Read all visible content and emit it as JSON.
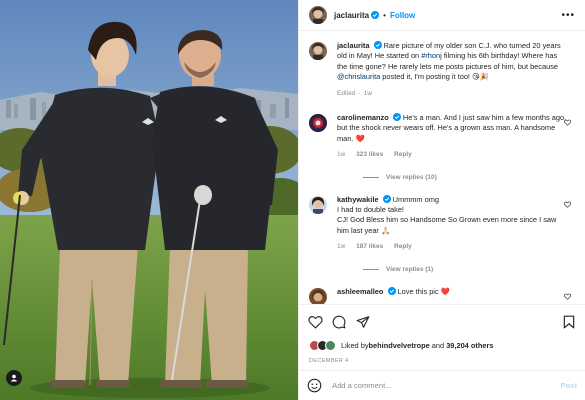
{
  "post": {
    "username": "jaclaurita",
    "follow_label": "Follow",
    "separator": "•",
    "more_icon": "more-options-icon"
  },
  "caption": {
    "username": "jaclaurita",
    "pre_text": "Rare picture of my older son C.J. who turned 20 years old in May! He started on ",
    "hashtag": "#rhonj",
    "mid_text": " filming his 6th birthday! Where has the time gone? He rarely lets me posts pictures of him, but because ",
    "mention": "@chrislaurita",
    "post_text": " posted it, I'm posting it too! ",
    "emoji": "😘🎉",
    "edited": "Edited",
    "age": "1w"
  },
  "comments": [
    {
      "username": "caroline manzo",
      "display_username": "carolinemanzo",
      "text": "He's a man. And I just saw him a few months ago, but the shock never wears off. He's a grown ass man. A handsome man. ",
      "emoji": "❤️",
      "age": "1w",
      "likes": "323 likes",
      "reply_label": "Reply",
      "view_replies": "View replies (10)"
    },
    {
      "username": "kathywakile",
      "text": "Ummmm omg",
      "line2": "I had to double take!",
      "line3": "CJ! God Bless him so Handsome So Grown even more since I saw him last year ",
      "emoji": "🙏🏻",
      "age": "1w",
      "likes": "187 likes",
      "reply_label": "Reply",
      "view_replies": "View replies (1)"
    },
    {
      "username": "ashleemalleo",
      "text": "Love this pic ",
      "emoji": "❤️"
    }
  ],
  "likes": {
    "prefix": "Liked by ",
    "user": "behindvelvetrope",
    "middle": " and ",
    "count": "39,204 others"
  },
  "date": "DECEMBER 4",
  "add_comment": {
    "placeholder": "Add a comment...",
    "post_label": "Post"
  },
  "colors": {
    "accent": "#0095f6",
    "link": "#00376b",
    "muted": "#8e8e8e",
    "heart": "#ed4956"
  }
}
